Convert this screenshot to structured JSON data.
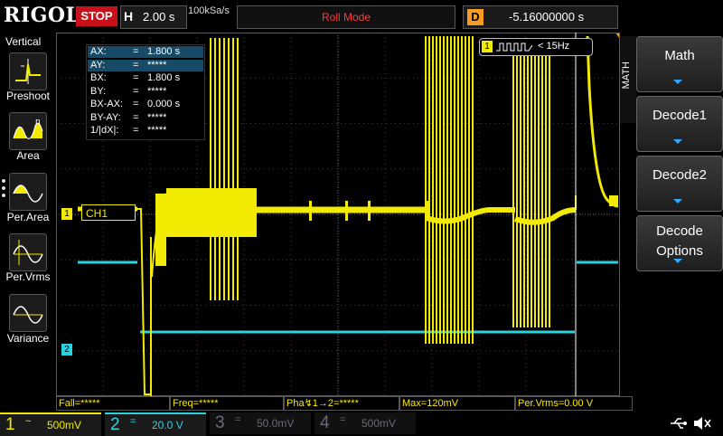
{
  "brand": "RIGOL",
  "run_state": "STOP",
  "horizontal": {
    "key": "H",
    "scale": "2.00 s",
    "sample_rate": "100kSa/s"
  },
  "acq_mode": "Roll Mode",
  "delay": {
    "key": "D",
    "value": "-5.16000000 s"
  },
  "left_menu": {
    "title": "Vertical",
    "items": [
      {
        "label": "Preshoot",
        "icon": "preshoot-icon"
      },
      {
        "label": "Area",
        "icon": "area-icon"
      },
      {
        "label": "Per.Area",
        "icon": "per-area-icon"
      },
      {
        "label": "Per.Vrms",
        "icon": "per-vrms-icon"
      },
      {
        "label": "Variance",
        "icon": "variance-icon"
      }
    ]
  },
  "cursors": {
    "rows": [
      {
        "name": "AX:",
        "value": "1.800 s",
        "highlight": true
      },
      {
        "name": "AY:",
        "value": "*****",
        "highlight": true
      },
      {
        "name": "BX:",
        "value": "1.800 s"
      },
      {
        "name": "BY:",
        "value": "*****"
      },
      {
        "name": "BX-AX:",
        "value": "0.000 s"
      },
      {
        "name": "BY-AY:",
        "value": "*****"
      },
      {
        "name": "1/|dX|:",
        "value": "*****"
      }
    ],
    "eq": "="
  },
  "trigger_info": {
    "source": "1",
    "freq": "< 15Hz"
  },
  "channel_tags": {
    "ch1_marker": "1",
    "ch1_label": "CH1",
    "ch2_marker": "2"
  },
  "right_menu": {
    "tab": "MATH",
    "buttons": [
      {
        "label": "Math"
      },
      {
        "label": "Decode1"
      },
      {
        "label": "Decode2"
      },
      {
        "label": "Decode Options",
        "line1": "Decode",
        "line2": "Options"
      }
    ]
  },
  "measurements": [
    "Fall=*****",
    "Freq=*****",
    "Pha↯1→2=*****",
    "Max=120mV",
    "Per.Vrms=0.00 V"
  ],
  "channels": [
    {
      "num": "1",
      "coupling": "~",
      "scale": "500mV",
      "state": "on"
    },
    {
      "num": "2",
      "coupling": "=",
      "scale": "20.0 V",
      "state": "on"
    },
    {
      "num": "3",
      "coupling": "=",
      "scale": "50.0mV",
      "state": "off"
    },
    {
      "num": "4",
      "coupling": "=",
      "scale": "500mV",
      "state": "off"
    }
  ],
  "colors": {
    "ch1": "#f2ea00",
    "ch2": "#2ad3e0",
    "stop": "#c8101a",
    "accent": "#2fa7ff",
    "delay": "#f79b24"
  }
}
